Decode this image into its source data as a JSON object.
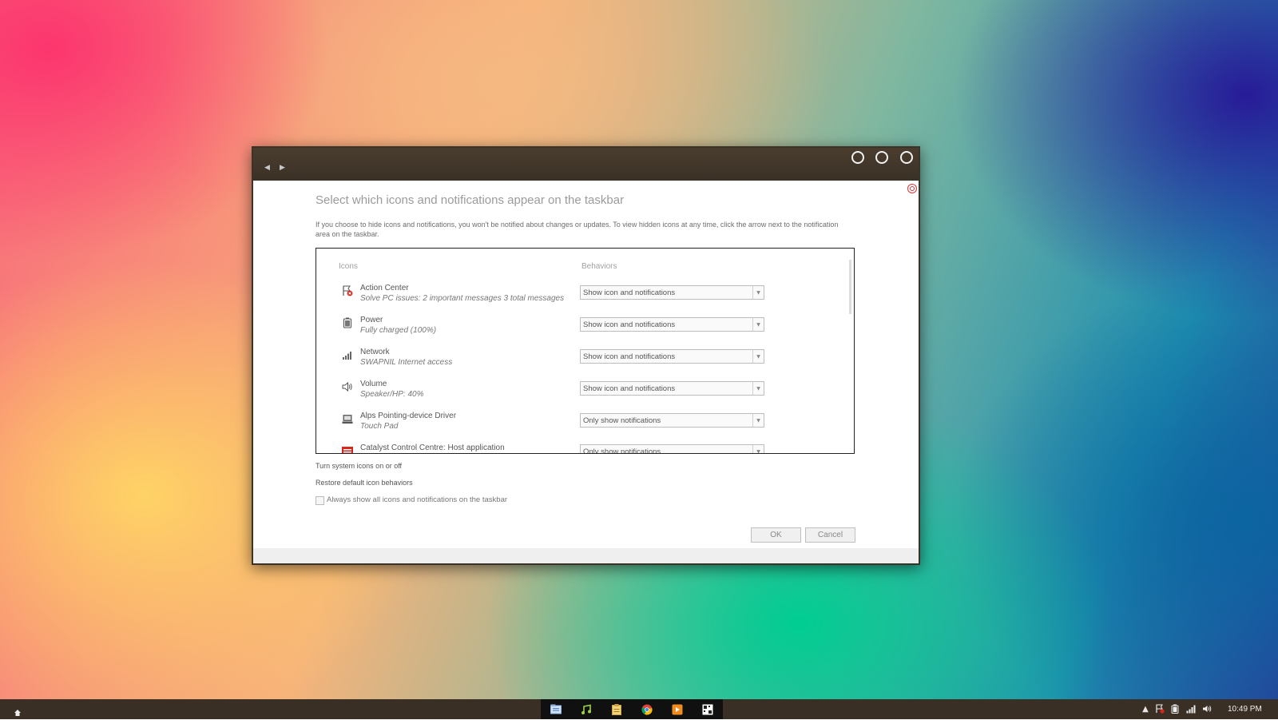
{
  "window": {
    "page_title": "Select which icons and notifications appear on the taskbar",
    "description": "If you choose to hide icons and notifications, you won't be notified about changes or updates. To view hidden icons at any time, click the arrow next to the notification area on the taskbar.",
    "columns": {
      "icons": "Icons",
      "behaviors": "Behaviors"
    },
    "rows": [
      {
        "name": "Action Center",
        "subtitle": "Solve PC issues: 2 important messages  3 total messages",
        "behavior": "Show icon and notifications",
        "icon": "action-center-flag-icon"
      },
      {
        "name": "Power",
        "subtitle": "Fully charged (100%)",
        "behavior": "Show icon and notifications",
        "icon": "battery-icon"
      },
      {
        "name": "Network",
        "subtitle": "SWAPNIL Internet access",
        "behavior": "Show icon and notifications",
        "icon": "network-signal-icon"
      },
      {
        "name": "Volume",
        "subtitle": "Speaker/HP: 40%",
        "behavior": "Show icon and notifications",
        "icon": "speaker-icon"
      },
      {
        "name": "Alps Pointing-device Driver",
        "subtitle": "Touch Pad",
        "behavior": "Only show notifications",
        "icon": "touchpad-icon"
      },
      {
        "name": "Catalyst Control Centre: Host application",
        "subtitle": "",
        "behavior": "Only show notifications",
        "icon": "ati-logo-icon"
      }
    ],
    "links": {
      "system_icons": "Turn system icons on or off",
      "restore": "Restore default icon behaviors"
    },
    "always_show_label": "Always show all icons and notifications on the taskbar",
    "always_show_checked": false,
    "ok_label": "OK",
    "cancel_label": "Cancel"
  },
  "taskbar": {
    "apps": [
      "file-explorer-icon",
      "music-player-icon",
      "notes-icon",
      "chrome-icon",
      "media-player-icon",
      "snipping-tool-icon"
    ],
    "tray": [
      "show-hidden-icons-arrow",
      "action-center-flag-icon",
      "battery-icon",
      "network-signal-icon",
      "speaker-icon"
    ],
    "clock": "10:49 PM"
  },
  "colors": {
    "title_text": "#9b9b9b",
    "taskbar": "#3a2f24",
    "window_titlebar": "#4a3d2e",
    "ati_red": "#d8261e"
  }
}
